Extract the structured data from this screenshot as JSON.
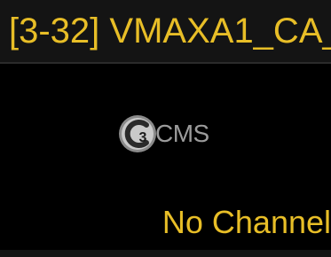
{
  "camera_tile": {
    "title": "[3-32] VMAXA1_CA_",
    "logo": {
      "mark_letter": "C",
      "mark_sub": "3",
      "text": "CMS"
    },
    "status": "No Channel"
  },
  "colors": {
    "accent": "#e8be27",
    "background": "#000000",
    "logo_gray": "#9b9b9b"
  }
}
